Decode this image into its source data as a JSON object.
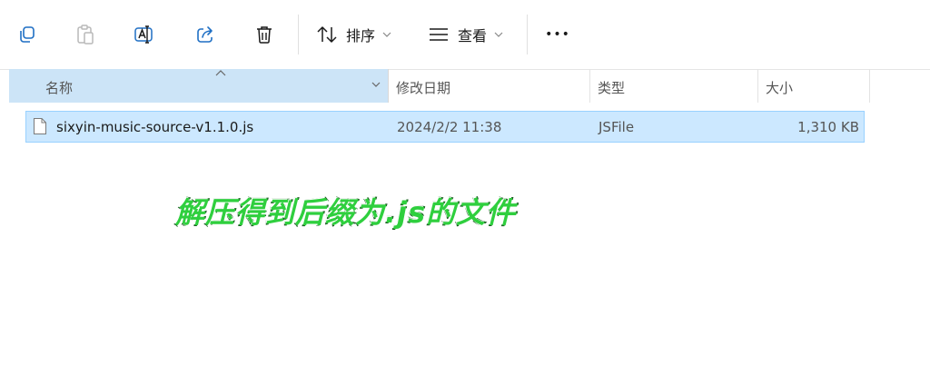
{
  "toolbar": {
    "sort_label": "排序",
    "view_label": "查看",
    "more_label": "•••"
  },
  "columns": {
    "name": "名称",
    "date_modified": "修改日期",
    "type": "类型",
    "size": "大小"
  },
  "files": [
    {
      "name": "sixyin-music-source-v1.1.0.js",
      "date_modified": "2024/2/2 11:38",
      "type": "JSFile",
      "size": "1,310 KB"
    }
  ],
  "annotation": {
    "text": "解压得到后缀为.js的文件",
    "color": "#2fcf3e"
  },
  "colors": {
    "selection": "#cce8ff",
    "selection_border": "#99d1ff",
    "header_selected": "#cce4f7"
  }
}
